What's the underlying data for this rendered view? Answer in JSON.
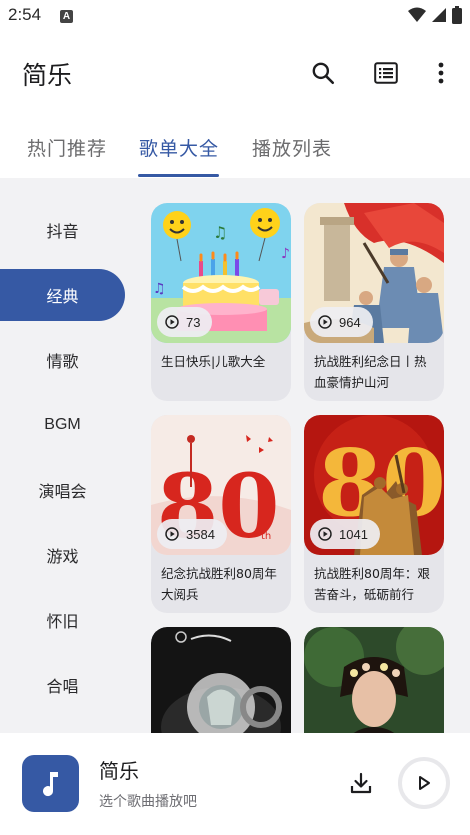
{
  "status_bar": {
    "time": "2:54",
    "notif_letter": "A"
  },
  "app_bar": {
    "title": "简乐"
  },
  "tabs": [
    {
      "label": "热门推荐",
      "active": false
    },
    {
      "label": "歌单大全",
      "active": true
    },
    {
      "label": "播放列表",
      "active": false
    }
  ],
  "categories": [
    {
      "label": "抖音",
      "active": false
    },
    {
      "label": "经典",
      "active": true
    },
    {
      "label": "情歌",
      "active": false
    },
    {
      "label": "BGM",
      "active": false
    },
    {
      "label": "演唱会",
      "active": false
    },
    {
      "label": "游戏",
      "active": false
    },
    {
      "label": "怀旧",
      "active": false
    },
    {
      "label": "合唱",
      "active": false
    }
  ],
  "playlists": [
    {
      "count": "73",
      "title": "生日快乐|儿歌大全"
    },
    {
      "count": "964",
      "title": "抗战胜利纪念日丨热血豪情护山河"
    },
    {
      "count": "3584",
      "title": "纪念抗战胜利80周年大阅兵"
    },
    {
      "count": "1041",
      "title": "抗战胜利80周年：艰苦奋斗，砥砺前行"
    },
    {
      "count": "",
      "title": ""
    },
    {
      "count": "",
      "title": ""
    }
  ],
  "thumb_text": {
    "big_number": "80",
    "th": "th"
  },
  "player": {
    "title": "简乐",
    "subtitle": "选个歌曲播放吧"
  },
  "colors": {
    "accent": "#3659a4",
    "background": "#f2f2f4",
    "card": "#e5e5ea"
  }
}
